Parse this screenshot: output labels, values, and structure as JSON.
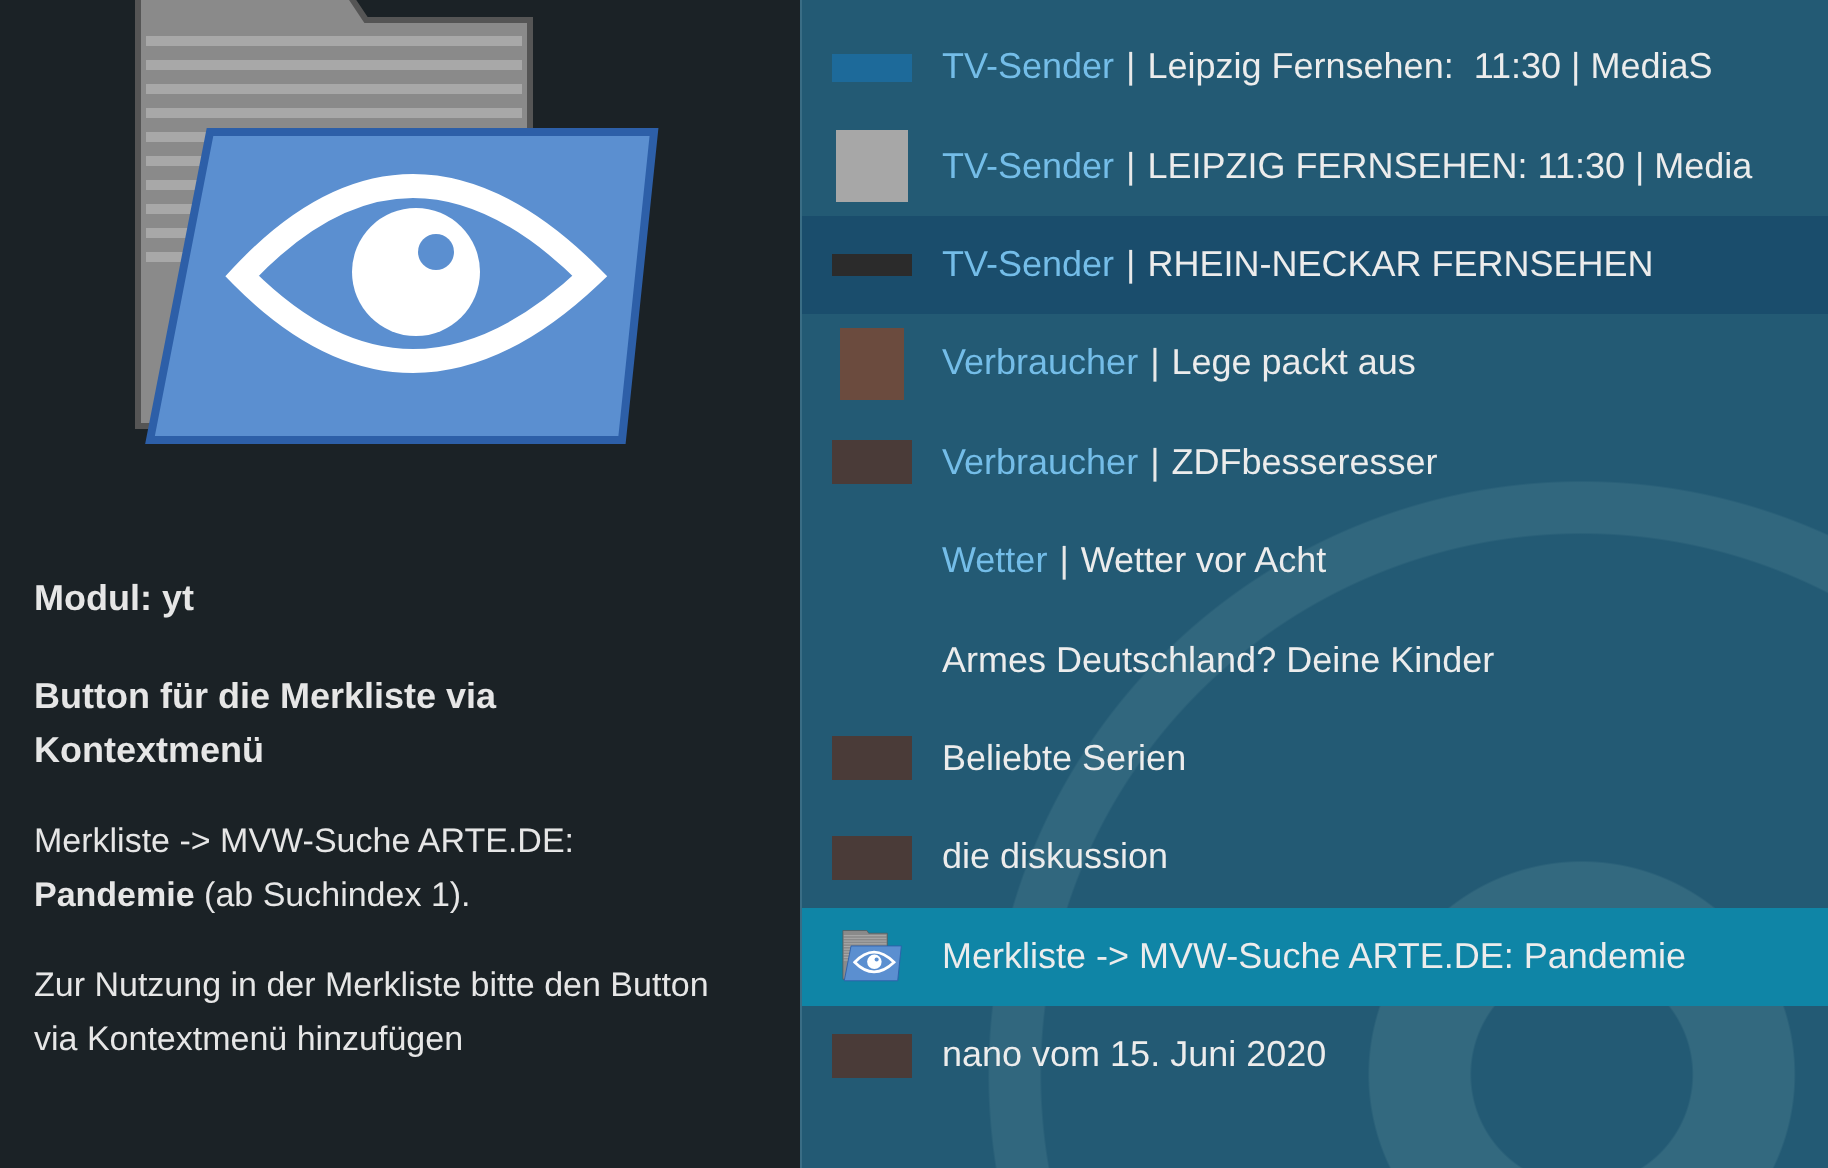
{
  "info_panel": {
    "module": "Modul: yt",
    "heading": "Button für die Merkliste via Kontextmenü",
    "description": "Merkliste -> MVW-Suche ARTE.DE: **Pandemie** (ab Suchindex 1).",
    "hint": "Zur Nutzung in der Merkliste bitte den Button via Kontextmenü hinzufügen"
  },
  "list": {
    "items": [
      {
        "kind": "logo",
        "category": "TV-Sender",
        "separator": "|",
        "title": "Leipzig Fernsehen:  11:30 | MediaS",
        "selected": false,
        "focused": false
      },
      {
        "kind": "missing",
        "category": "TV-Sender",
        "separator": "|",
        "title": "LEIPZIG FERNSEHEN: 11:30 | Media",
        "selected": false,
        "focused": false
      },
      {
        "kind": "banner",
        "category": "TV-Sender",
        "separator": "|",
        "title": "RHEIN-NECKAR FERNSEHEN",
        "selected": false,
        "focused": true
      },
      {
        "kind": "photo",
        "category": "Verbraucher",
        "separator": "|",
        "title": "Lege packt aus",
        "selected": false,
        "focused": false
      },
      {
        "kind": "wide-photo",
        "category": "Verbraucher",
        "separator": "|",
        "title": "ZDFbesseresser",
        "selected": false,
        "focused": false
      },
      {
        "kind": "none",
        "category": "Wetter",
        "separator": "|",
        "title": "Wetter vor Acht",
        "selected": false,
        "focused": false
      },
      {
        "kind": "none",
        "title": "Armes Deutschland? Deine Kinder",
        "selected": false,
        "focused": false
      },
      {
        "kind": "wide-photo",
        "title": "Beliebte Serien",
        "selected": false,
        "focused": false
      },
      {
        "kind": "wide-photo",
        "title": "die diskussion",
        "selected": false,
        "focused": false
      },
      {
        "kind": "folder",
        "title": "Merkliste -> MVW-Suche ARTE.DE: Pandemie",
        "selected": true,
        "focused": false
      },
      {
        "kind": "wide-photo",
        "title": "nano vom 15. Juni 2020",
        "selected": false,
        "focused": false
      }
    ]
  }
}
